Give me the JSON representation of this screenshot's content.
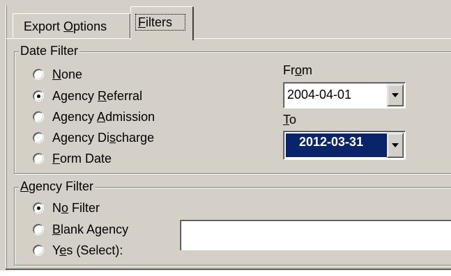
{
  "tabs": [
    {
      "label": "Export Options",
      "pre": "Export ",
      "accel": "O",
      "post": "ptions",
      "active": false
    },
    {
      "label": "Filters",
      "pre": "",
      "accel": "F",
      "post": "ilters",
      "active": true
    }
  ],
  "date_filter": {
    "legend": "Date Filter",
    "options": [
      {
        "pre": "",
        "accel": "N",
        "post": "one",
        "checked": false
      },
      {
        "pre": "Agency ",
        "accel": "R",
        "post": "eferral",
        "checked": true
      },
      {
        "pre": "Agency ",
        "accel": "A",
        "post": "dmission",
        "checked": false
      },
      {
        "pre": "Agency Di",
        "accel": "s",
        "post": "charge",
        "checked": false
      },
      {
        "pre": "",
        "accel": "F",
        "post": "orm Date",
        "checked": false
      }
    ],
    "from_label": {
      "pre": "Fr",
      "accel": "o",
      "post": "m"
    },
    "from_value": "2004-04-01",
    "to_label": {
      "pre": "",
      "accel": "T",
      "post": "o"
    },
    "to_value": "2012-03-31"
  },
  "agency_filter": {
    "legend": {
      "pre": "",
      "accel": "A",
      "post": "gency Filter"
    },
    "options": [
      {
        "pre": "N",
        "accel": "o",
        "post": " Filter",
        "checked": true
      },
      {
        "pre": "",
        "accel": "B",
        "post": "lank Agency",
        "checked": false
      },
      {
        "pre": "Y",
        "accel": "e",
        "post": "s (Select):",
        "checked": false
      }
    ],
    "select_value": ""
  },
  "colors": {
    "face": "#d4d0c8",
    "highlight": "#0a246a"
  }
}
